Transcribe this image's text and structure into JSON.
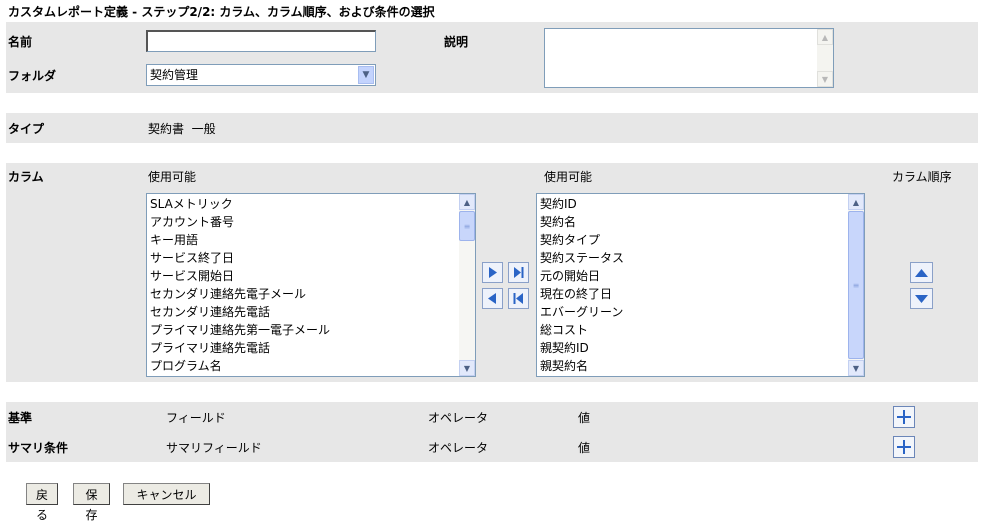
{
  "page_title": "カスタムレポート定義 - ステップ2/2: カラム、カラム順序、および条件の選択",
  "name": {
    "label": "名前",
    "value": ""
  },
  "description": {
    "label": "説明",
    "value": ""
  },
  "folder": {
    "label": "フォルダ",
    "selected": "契約管理"
  },
  "type": {
    "label": "タイプ",
    "value": "契約書  一般"
  },
  "columns": {
    "label": "カラム",
    "available_label": "使用可能",
    "selected_label": "使用可能",
    "order_label": "カラム順序",
    "available_items": [
      "SLAメトリック",
      "アカウント番号",
      "キー用語",
      "サービス終了日",
      "サービス開始日",
      "セカンダリ連絡先電子メール",
      "セカンダリ連絡先電話",
      "プライマリ連絡先第一電子メール",
      "プライマリ連絡先電話",
      "プログラム名"
    ],
    "selected_items": [
      "契約ID",
      "契約名",
      "契約タイプ",
      "契約ステータス",
      "元の開始日",
      "現在の終了日",
      "エバーグリーン",
      "総コスト",
      "親契約ID",
      "親契約名"
    ]
  },
  "criteria": {
    "label": "基準",
    "field": "フィールド",
    "operator": "オペレータ",
    "value": "値"
  },
  "summary": {
    "label": "サマリ条件",
    "field": "サマリフィールド",
    "operator": "オペレータ",
    "value": "値"
  },
  "buttons": {
    "back": "戻る",
    "save": "保存",
    "cancel": "キャンセル"
  },
  "colors": {
    "band": "#e7e7e7",
    "arrow_blue": "#2a64c6",
    "border": "#7f9db9"
  }
}
